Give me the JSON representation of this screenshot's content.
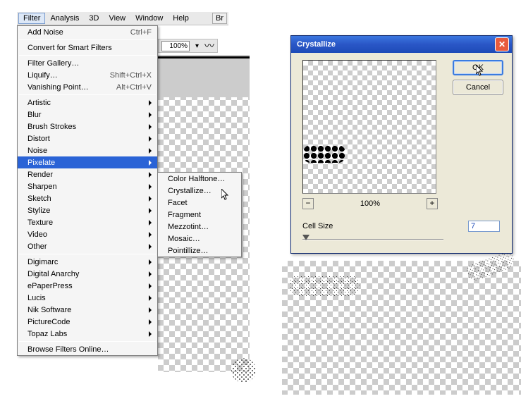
{
  "menubar": {
    "items": [
      "Filter",
      "Analysis",
      "3D",
      "View",
      "Window",
      "Help"
    ],
    "active": "Filter",
    "br_label": "Br"
  },
  "toolbar": {
    "zoom_value": "100%"
  },
  "filter_menu": {
    "last_filter": {
      "label": "Add Noise",
      "accel": "Ctrl+F"
    },
    "convert": "Convert for Smart Filters",
    "group1": [
      {
        "label": "Filter Gallery…"
      },
      {
        "label": "Liquify…",
        "accel": "Shift+Ctrl+X"
      },
      {
        "label": "Vanishing Point…",
        "accel": "Alt+Ctrl+V"
      }
    ],
    "group2": [
      {
        "label": "Artistic",
        "sub": true
      },
      {
        "label": "Blur",
        "sub": true
      },
      {
        "label": "Brush Strokes",
        "sub": true
      },
      {
        "label": "Distort",
        "sub": true
      },
      {
        "label": "Noise",
        "sub": true
      },
      {
        "label": "Pixelate",
        "sub": true,
        "highlight": true
      },
      {
        "label": "Render",
        "sub": true
      },
      {
        "label": "Sharpen",
        "sub": true
      },
      {
        "label": "Sketch",
        "sub": true
      },
      {
        "label": "Stylize",
        "sub": true
      },
      {
        "label": "Texture",
        "sub": true
      },
      {
        "label": "Video",
        "sub": true
      },
      {
        "label": "Other",
        "sub": true
      }
    ],
    "group3": [
      {
        "label": "Digimarc",
        "sub": true
      },
      {
        "label": "Digital Anarchy",
        "sub": true
      },
      {
        "label": "ePaperPress",
        "sub": true
      },
      {
        "label": "Lucis",
        "sub": true
      },
      {
        "label": "Nik Software",
        "sub": true
      },
      {
        "label": "PictureCode",
        "sub": true
      },
      {
        "label": "Topaz Labs",
        "sub": true
      }
    ],
    "browse": "Browse Filters Online…"
  },
  "pixelate_submenu": [
    {
      "label": "Color Halftone…"
    },
    {
      "label": "Crystallize…",
      "highlight": true
    },
    {
      "label": "Facet"
    },
    {
      "label": "Fragment"
    },
    {
      "label": "Mezzotint…"
    },
    {
      "label": "Mosaic…"
    },
    {
      "label": "Pointillize…"
    }
  ],
  "dialog": {
    "title": "Crystallize",
    "ok": "OK",
    "cancel": "Cancel",
    "zoom": "100%",
    "minus": "−",
    "plus": "+",
    "cell_label": "Cell Size",
    "cell_value": "7"
  }
}
